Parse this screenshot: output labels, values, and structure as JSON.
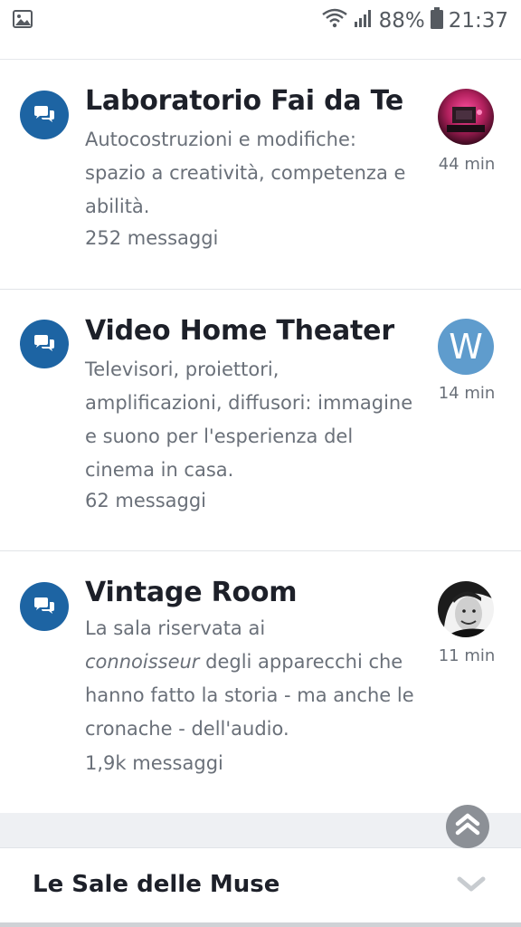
{
  "status_bar": {
    "battery_percent": "88%",
    "time": "21:37",
    "icons": [
      "gallery-icon",
      "wifi-icon",
      "signal-icon",
      "battery-icon"
    ]
  },
  "forums": [
    {
      "title": "Laboratorio Fai da Te",
      "description": "Autocostruzioni e modifiche: spazio a creatività, competenza e abilità.",
      "count": "252 messaggi",
      "time_ago": "44 min",
      "avatar": "photo"
    },
    {
      "title": "Video Home Theater",
      "description": "Televisori, proiettori, amplificazioni, diffusori: immagine e suono per l'esperienza del cinema in casa.",
      "count": "62 messaggi",
      "time_ago": "14 min",
      "avatar_letter": "W"
    },
    {
      "title": "Vintage Room",
      "description_line1": "La sala riservata ai",
      "description_em": "connoisseur",
      "description_rest": " degli apparecchi che hanno fatto la storia - ma anche le cronache - dell'audio.",
      "count": "1,9k messaggi",
      "time_ago": "11 min",
      "avatar": "photo"
    }
  ],
  "section": {
    "title": "Le Sale delle Muse"
  },
  "colors": {
    "forum_icon_bg": "#1d64a3",
    "avatar_letter_bg": "#5f9ccd",
    "muted_text": "#6a7079"
  }
}
